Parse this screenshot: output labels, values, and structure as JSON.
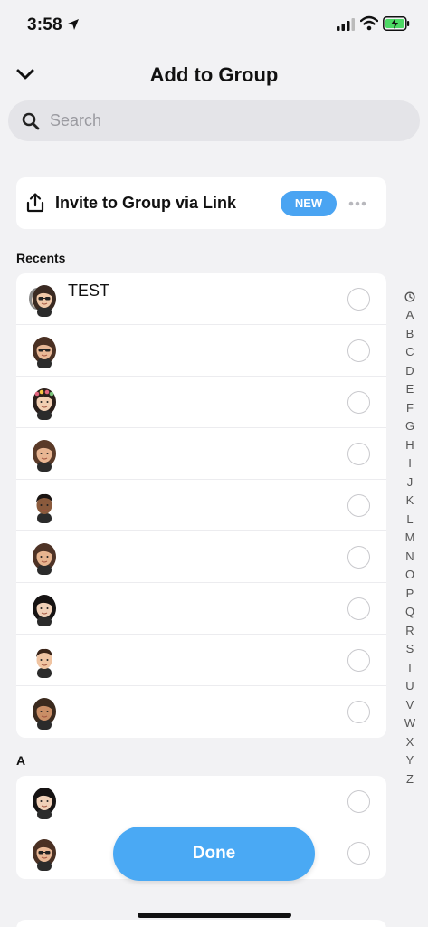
{
  "status_bar": {
    "time": "3:58"
  },
  "header": {
    "title": "Add to Group"
  },
  "search": {
    "placeholder": "Search"
  },
  "invite": {
    "label": "Invite to Group via Link",
    "badge": "NEW"
  },
  "sections": {
    "recents": "Recents",
    "a": "A"
  },
  "recents": [
    {
      "name": "TEST",
      "avatar": "group-avatar"
    },
    {
      "name": "",
      "avatar": "avatar-sunglasses"
    },
    {
      "name": "",
      "avatar": "avatar-flower-crown"
    },
    {
      "name": "",
      "avatar": "avatar-long-hair"
    },
    {
      "name": "",
      "avatar": "avatar-dark-skin-man"
    },
    {
      "name": "",
      "avatar": "avatar-brown-hair"
    },
    {
      "name": "",
      "avatar": "avatar-black-hair"
    },
    {
      "name": "",
      "avatar": "avatar-man-black-shirt"
    },
    {
      "name": "",
      "avatar": "avatar-curly-hair"
    }
  ],
  "a_list": [
    {
      "name": "",
      "avatar": "avatar-black-hair"
    },
    {
      "name": "",
      "avatar": "avatar-sunglasses"
    }
  ],
  "alpha_index": [
    "A",
    "B",
    "C",
    "D",
    "E",
    "F",
    "G",
    "H",
    "I",
    "J",
    "K",
    "L",
    "M",
    "N",
    "O",
    "P",
    "Q",
    "R",
    "S",
    "T",
    "U",
    "V",
    "W",
    "X",
    "Y",
    "Z"
  ],
  "done_label": "Done",
  "colors": {
    "accent": "#4aa4f2",
    "background": "#f2f2f4"
  }
}
